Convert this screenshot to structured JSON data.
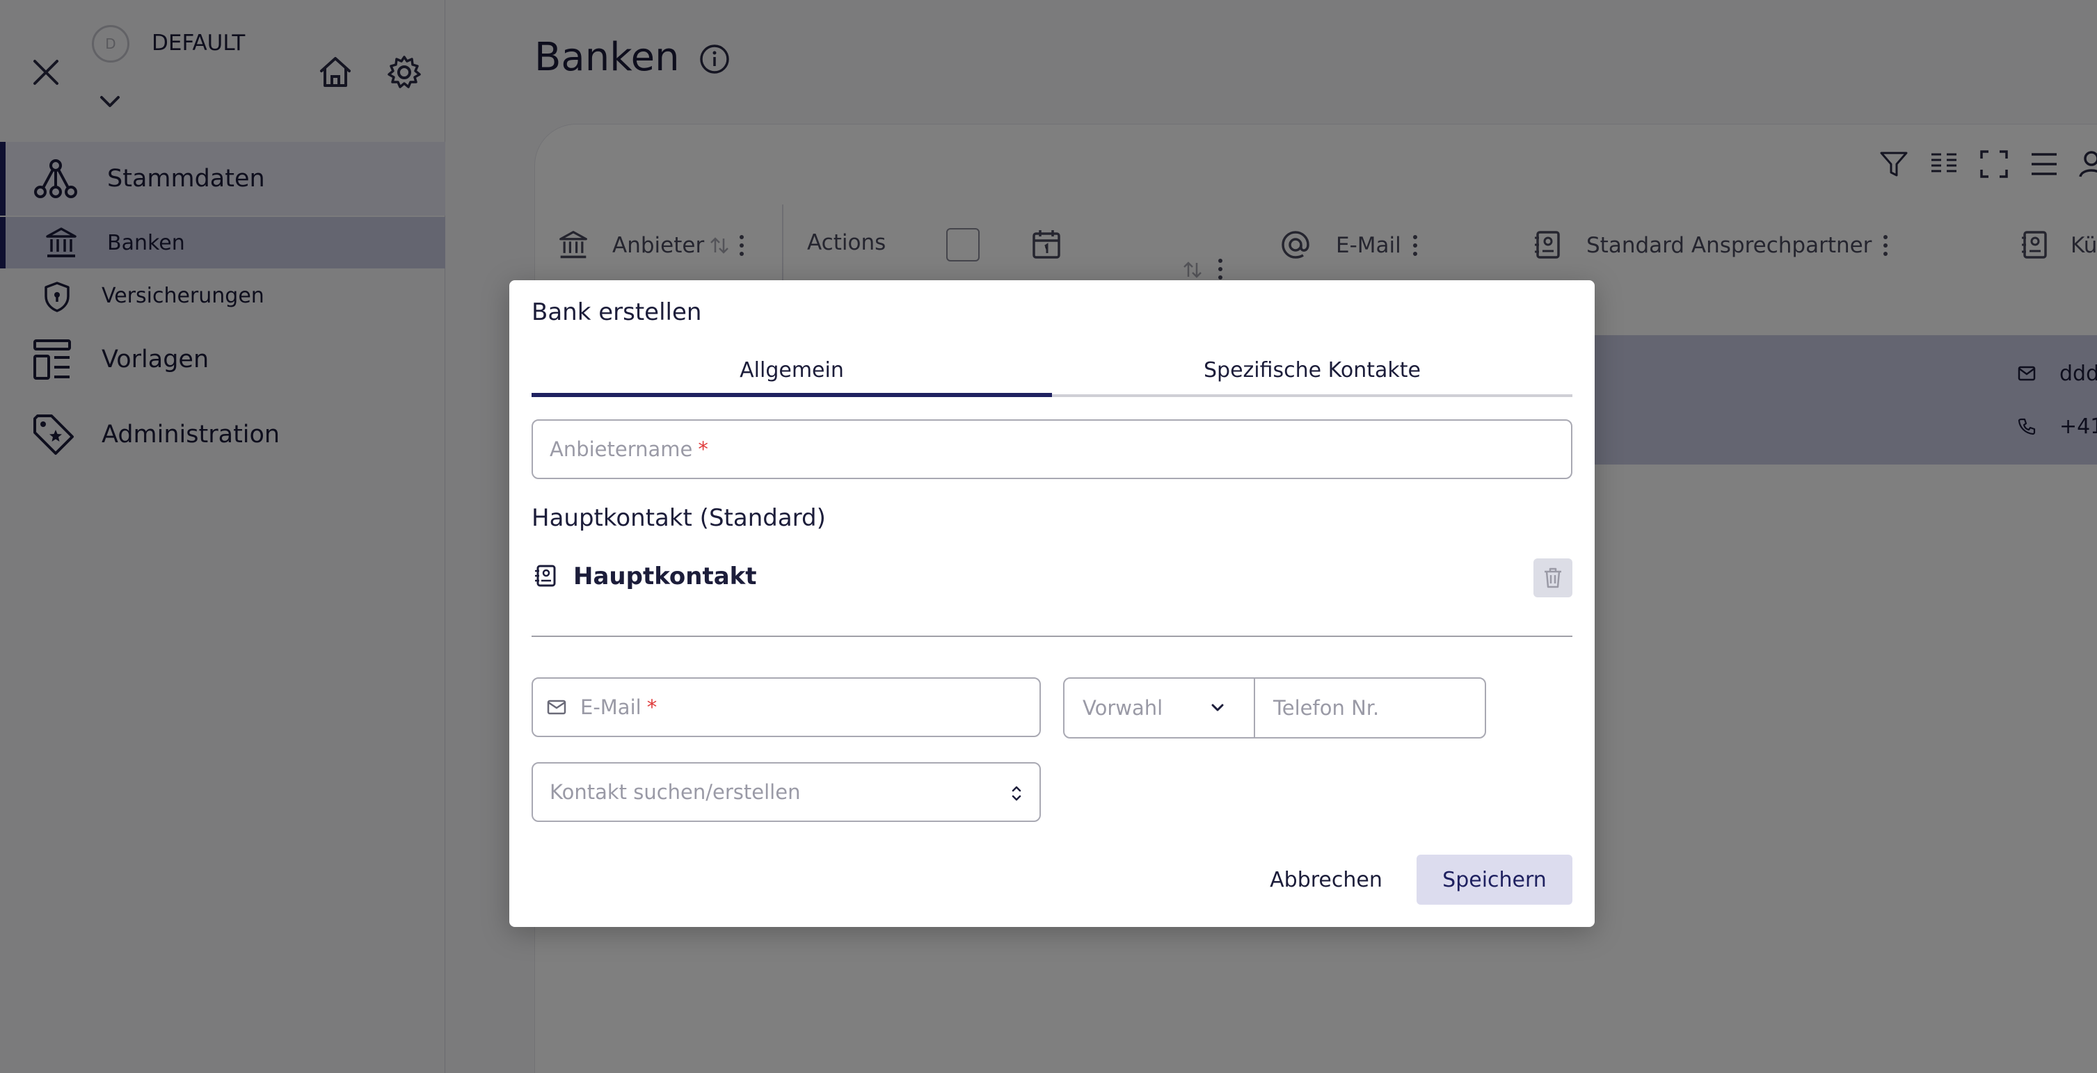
{
  "sidebar": {
    "tenant": {
      "avatar_letter": "D",
      "name": "DEFAULT"
    },
    "items": [
      {
        "label": "Stammdaten"
      },
      {
        "label": "Banken"
      },
      {
        "label": "Versicherungen"
      },
      {
        "label": "Vorlagen"
      },
      {
        "label": "Administration"
      }
    ]
  },
  "page": {
    "title": "Banken"
  },
  "table": {
    "columns": [
      {
        "label": "Anbieter"
      },
      {
        "label": "Actions"
      },
      {
        "label": "E-Mail"
      },
      {
        "label": "Standard Ansprechpartner"
      },
      {
        "label": "Kü"
      }
    ],
    "row": {
      "email_partial": "ddd",
      "phone_partial": "+41"
    }
  },
  "modal": {
    "title": "Bank erstellen",
    "tabs": [
      {
        "label": "Allgemein",
        "active": true
      },
      {
        "label": "Spezifische Kontakte",
        "active": false
      }
    ],
    "provider_name": {
      "placeholder": "Anbietername",
      "required_mark": "*",
      "value": ""
    },
    "main_contact_section": "Hauptkontakt (Standard)",
    "contact_name": "Hauptkontakt",
    "email": {
      "placeholder": "E-Mail",
      "required_mark": "*",
      "value": ""
    },
    "prefix": {
      "placeholder": "Vorwahl"
    },
    "phone": {
      "placeholder": "Telefon Nr."
    },
    "contact_search": {
      "placeholder": "Kontakt suchen/erstellen"
    },
    "cancel_label": "Abbrechen",
    "save_label": "Speichern"
  },
  "colors": {
    "accent": "#1f2160",
    "required": "#e03e3e",
    "nav_active_bg": "#c9cbe1",
    "save_button_bg": "#dcdcee"
  }
}
